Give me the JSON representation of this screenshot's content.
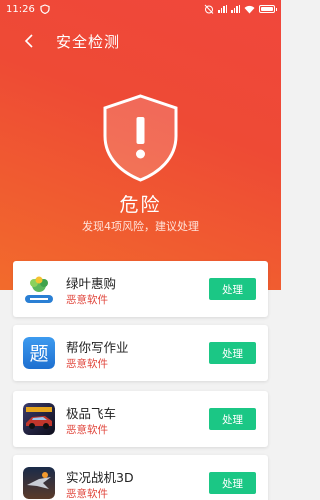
{
  "status_bar": {
    "time": "11:26"
  },
  "header": {
    "title": "安全检测"
  },
  "result": {
    "level": "危险",
    "description": "发现4项风险，建议处理"
  },
  "colors": {
    "danger": "#ee4a35",
    "accent": "#1bc785",
    "risk_text": "#e0463c"
  },
  "apps": [
    {
      "name": "绿叶惠购",
      "tag": "恶意软件",
      "action": "处理",
      "icon": "lvye-logo-icon"
    },
    {
      "name": "帮你写作业",
      "tag": "恶意软件",
      "action": "处理",
      "icon": "ti-logo-icon",
      "icon_text": "题"
    },
    {
      "name": "极品飞车",
      "tag": "恶意软件",
      "action": "处理",
      "icon": "car-game-icon"
    },
    {
      "name": "实况战机3D",
      "tag": "恶意软件",
      "action": "处理",
      "icon": "fighter-game-icon"
    }
  ]
}
